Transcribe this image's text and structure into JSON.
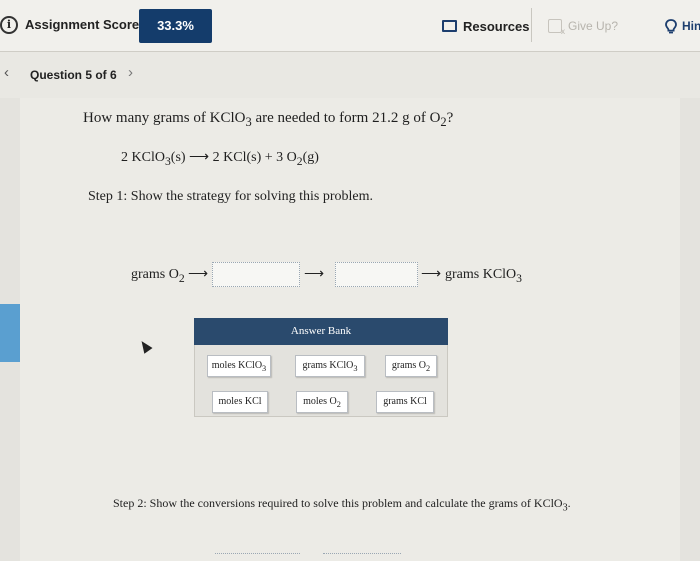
{
  "header": {
    "score_label": "Assignment Score:",
    "score_value": "33.3%",
    "resources_label": "Resources",
    "give_up_label": "Give Up?",
    "hint_label": "Hin"
  },
  "nav": {
    "question_label": "Question 5 of 6"
  },
  "question": {
    "prompt_a": "How many grams of KClO",
    "prompt_sub": "3",
    "prompt_b": " are needed to form 21.2 g of O",
    "prompt_sub2": "2",
    "prompt_c": "?",
    "equation": {
      "t1": "2 KClO",
      "s1": "3",
      "t2": "(s) ⟶ 2 KCl(s) + 3 O",
      "s2": "2",
      "t3": "(g)"
    },
    "step1": "Step 1: Show the strategy for solving this problem.",
    "flow_start": "grams O",
    "flow_start_sub": "2",
    "flow_end": "grams KClO",
    "flow_end_sub": "3",
    "arrow": "⟶"
  },
  "answer_bank": {
    "title": "Answer Bank",
    "items": [
      {
        "text": "moles KClO",
        "sub": "3"
      },
      {
        "text": "grams KClO",
        "sub": "3"
      },
      {
        "text": "grams O",
        "sub": "2"
      },
      {
        "text": "moles KCl",
        "sub": ""
      },
      {
        "text": "moles O",
        "sub": "2"
      },
      {
        "text": "grams KCl",
        "sub": ""
      }
    ]
  },
  "step2": {
    "text": "Step 2: Show the conversions required to solve this problem and calculate the grams of KClO",
    "sub": "3",
    "end": "."
  },
  "icons": {
    "info": "info-icon",
    "resources": "book-icon",
    "give_up": "give-up-icon",
    "hint": "lightbulb-icon",
    "prev": "chevron-left-icon",
    "next": "chevron-right-icon",
    "cursor": "mouse-pointer-icon"
  },
  "colors": {
    "score_badge": "#143c6b",
    "bank_header": "#2a4a6d",
    "accent": "#1d3e6e",
    "side_strip": "#5a9fd0"
  }
}
